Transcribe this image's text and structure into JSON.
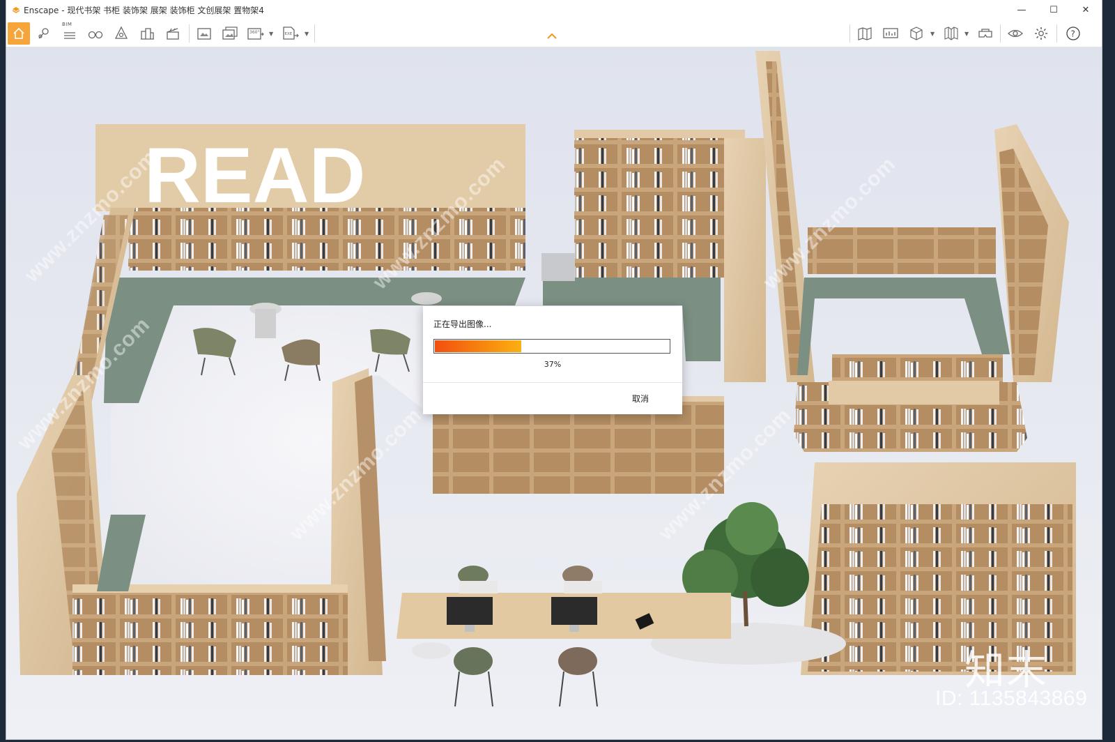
{
  "window": {
    "app_name": "Enscape",
    "title": "Enscape - 现代书架 书柜 装饰架 展架 装饰柜 文创展架 置物架4",
    "controls": {
      "minimize": "—",
      "maximize": "☐",
      "close": "✕"
    }
  },
  "toolbar": {
    "bim_label": "BIM",
    "left_buttons": [
      "home-icon",
      "map-pin-icon",
      "bim-list-icon",
      "binoculars-icon",
      "perspective-icon",
      "buildings-icon",
      "clapper-icon",
      "screenshot-icon",
      "batch-render-icon",
      "panorama-360-icon",
      "exe-export-icon"
    ],
    "right_buttons": [
      "map-icon",
      "monitor-icon",
      "cube-icon",
      "atlas-icon",
      "vr-headset-icon",
      "eye-icon",
      "gear-icon",
      "help-icon"
    ],
    "panorama_label": "360°",
    "exe_label": "EXE",
    "help_label": "?",
    "accent_color": "#f6a53a"
  },
  "scene": {
    "sign_text": "READ",
    "watermark_site": "www.znzmo.com",
    "watermark_brand": "知末",
    "watermark_id": "ID: 1135843869"
  },
  "dialog": {
    "title": "正在导出图像...",
    "progress": 0.37,
    "progress_text": "37%",
    "cancel_label": "取消"
  }
}
